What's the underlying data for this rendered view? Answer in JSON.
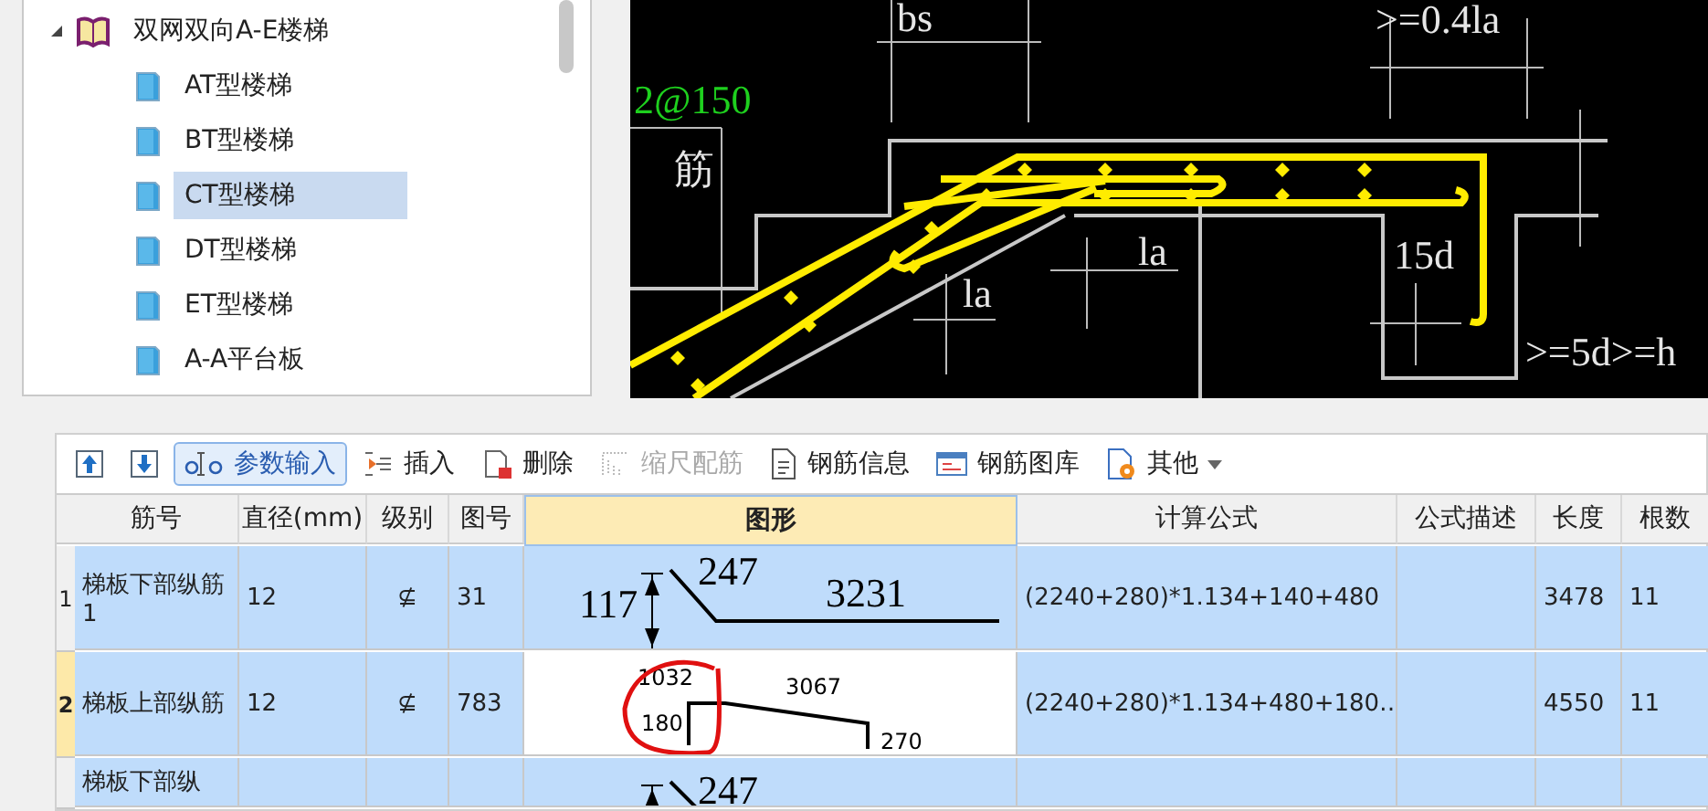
{
  "tree": {
    "root": {
      "label": "双网双向A-E楼梯",
      "expanded": true,
      "children": [
        {
          "label": "AT型楼梯",
          "selected": false
        },
        {
          "label": "BT型楼梯",
          "selected": false
        },
        {
          "label": "CT型楼梯",
          "selected": true
        },
        {
          "label": "DT型楼梯",
          "selected": false
        },
        {
          "label": "ET型楼梯",
          "selected": false
        },
        {
          "label": "A-A平台板",
          "selected": false
        }
      ]
    }
  },
  "drawing": {
    "labels": [
      {
        "kind": "dim",
        "text": "bs"
      },
      {
        "kind": "dim",
        "text": ">=0.4la"
      },
      {
        "kind": "spec",
        "text": "2@150"
      },
      {
        "kind": "note",
        "text": "筋"
      },
      {
        "kind": "dim",
        "text": "la"
      },
      {
        "kind": "dim",
        "text": "la"
      },
      {
        "kind": "dim",
        "text": "15d"
      },
      {
        "kind": "dim",
        "text": ">=5d>=h"
      }
    ]
  },
  "toolbar": [
    {
      "kind": "up"
    },
    {
      "kind": "down"
    },
    {
      "kind": "param",
      "label": "参数输入",
      "active": true,
      "disabled": false
    },
    {
      "kind": "insert",
      "label": "插入",
      "active": false,
      "disabled": false
    },
    {
      "kind": "delete",
      "label": "删除",
      "active": false,
      "disabled": false
    },
    {
      "kind": "scale",
      "label": "缩尺配筋",
      "active": false,
      "disabled": true
    },
    {
      "kind": "info",
      "label": "钢筋信息",
      "active": false,
      "disabled": false
    },
    {
      "kind": "library",
      "label": "钢筋图库",
      "active": false,
      "disabled": false
    },
    {
      "kind": "other",
      "label": "其他",
      "active": false,
      "disabled": false,
      "dropdown": true
    }
  ],
  "table": {
    "columns": [
      "筋号",
      "直径(mm)",
      "级别",
      "图号",
      "图形",
      "计算公式",
      "公式描述",
      "长度",
      "根数"
    ],
    "rows": [
      {
        "index": "1",
        "current": false,
        "name": "梯板下部纵筋1",
        "diameter": "12",
        "grade": "⊈",
        "code": "31",
        "shape": {
          "kind": "bent",
          "labels": [
            "117",
            "247",
            "3231"
          ]
        },
        "formula": "(2240+280)*1.134+140+480",
        "length": "3478",
        "count": "11"
      },
      {
        "index": "2",
        "current": true,
        "name": "梯板上部纵筋",
        "diameter": "12",
        "grade": "⊈",
        "code": "783",
        "shape": {
          "kind": "hooked",
          "labels": [
            "1032",
            "3067",
            "180",
            "270"
          ],
          "highlighted": true
        },
        "formula": "(2240+280)*1.134+480+180…",
        "length": "4550",
        "count": "11"
      },
      {
        "current": false,
        "name": "梯板下部纵",
        "shape": {
          "kind": "bent-cut",
          "labels": [
            "247"
          ]
        }
      }
    ]
  }
}
